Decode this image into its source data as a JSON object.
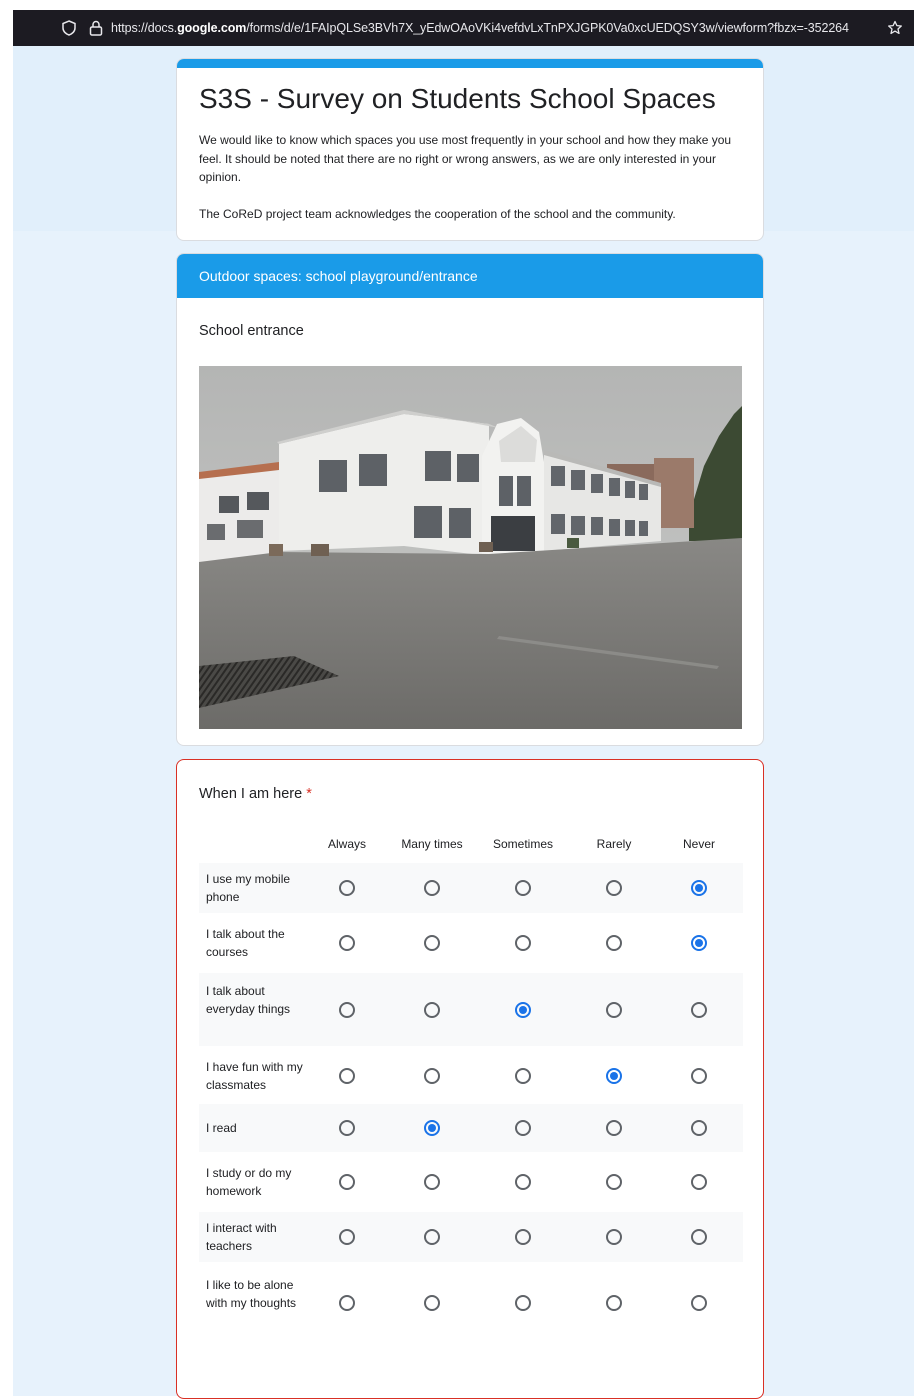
{
  "browser": {
    "url_prefix": "https://docs.",
    "url_domain": "google.com",
    "url_rest": "/forms/d/e/1FAIpQLSe3BVh7X_yEdwOAoVKi4vefdvLxTnPXJGPK0Va0xcUEDQSY3w/viewform?fbzx=-352264"
  },
  "form": {
    "title": "S3S - Survey on Students School Spaces",
    "description_1": "We would like to know which spaces you use most frequently in your school and how they make you feel. It should be noted that there are no right or wrong answers, as we are only interested in your opinion.",
    "description_2": "The CoReD project team acknowledges the cooperation of the school and the community."
  },
  "section": {
    "title": "Outdoor spaces: school playground/entrance",
    "item_title": "School entrance"
  },
  "question": {
    "title": "When I am here",
    "required_mark": "*",
    "columns": [
      "Always",
      "Many times",
      "Sometimes",
      "Rarely",
      "Never"
    ],
    "rows": [
      {
        "label": "I use my mobile phone",
        "selected": 4
      },
      {
        "label": "I talk about the courses",
        "selected": 4
      },
      {
        "label": "I talk about everyday things",
        "selected": 2
      },
      {
        "label": "I have fun with my classmates",
        "selected": 3
      },
      {
        "label": "I read",
        "selected": 1
      },
      {
        "label": "I study or do my homework",
        "selected": -1
      },
      {
        "label": "I interact with teachers",
        "selected": -1
      },
      {
        "label": "I like to be alone with my thoughts",
        "selected": -1
      }
    ]
  },
  "colors": {
    "accent": "#1a9be8",
    "radio_selected": "#1a73e8",
    "required": "#d93025"
  }
}
